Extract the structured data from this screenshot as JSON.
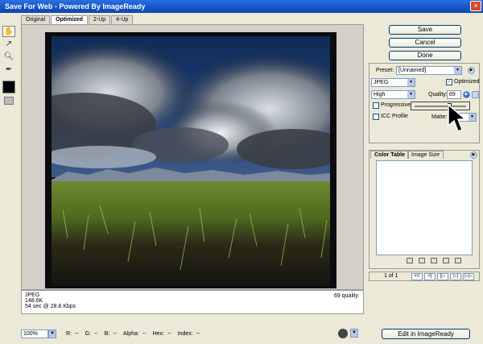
{
  "window": {
    "title": "Save For Web - Powered By ImageReady",
    "close_glyph": "×"
  },
  "tabs": [
    {
      "label": "Original",
      "active": false
    },
    {
      "label": "Optimized",
      "active": true
    },
    {
      "label": "2-Up",
      "active": false
    },
    {
      "label": "4-Up",
      "active": false
    }
  ],
  "tools": [
    "hand-tool-icon",
    "slice-select-tool-icon",
    "zoom-tool-icon",
    "eyedropper-tool-icon"
  ],
  "preview_info": {
    "format": "JPEG",
    "size": "148.6K",
    "download": "54 sec @ 28.8 Kbps",
    "quality_note": "69 quality"
  },
  "status": {
    "zoom": "100%",
    "r": "R:",
    "g": "G:",
    "b": "B:",
    "alpha": "Alpha:",
    "hex": "Hex:",
    "index": "Index:",
    "r_val": "--",
    "g_val": "--",
    "b_val": "--",
    "alpha_val": "--",
    "hex_val": "--",
    "index_val": "--"
  },
  "buttons": {
    "save": "Save",
    "cancel": "Cancel",
    "done": "Done",
    "edit_in_imageready": "Edit in ImageReady"
  },
  "settings": {
    "preset_label": "Preset:",
    "preset_value": "[Unnamed]",
    "format_value": "JPEG",
    "optimized_label": "Optimized",
    "optimized_checked": true,
    "quality_level": "High",
    "quality_label": "Quality:",
    "quality_value": "69",
    "progressive_label": "Progressive",
    "progressive_checked": false,
    "icc_label": "ICC Profile",
    "icc_checked": false,
    "matte_label": "Matte:",
    "quality_slider_fraction": 0.69
  },
  "panel": {
    "tabs": [
      {
        "label": "Color Table",
        "active": true
      },
      {
        "label": "Image Size",
        "active": false
      }
    ]
  },
  "pager": {
    "count": "1 of 1",
    "first": "<<",
    "prev": "<|",
    "play": "|▷",
    "next": "▷|",
    "last": "▷▷"
  },
  "colors": {
    "titlebar": "#1454c8",
    "background": "#ece9d8",
    "button_border": "#003c74"
  }
}
